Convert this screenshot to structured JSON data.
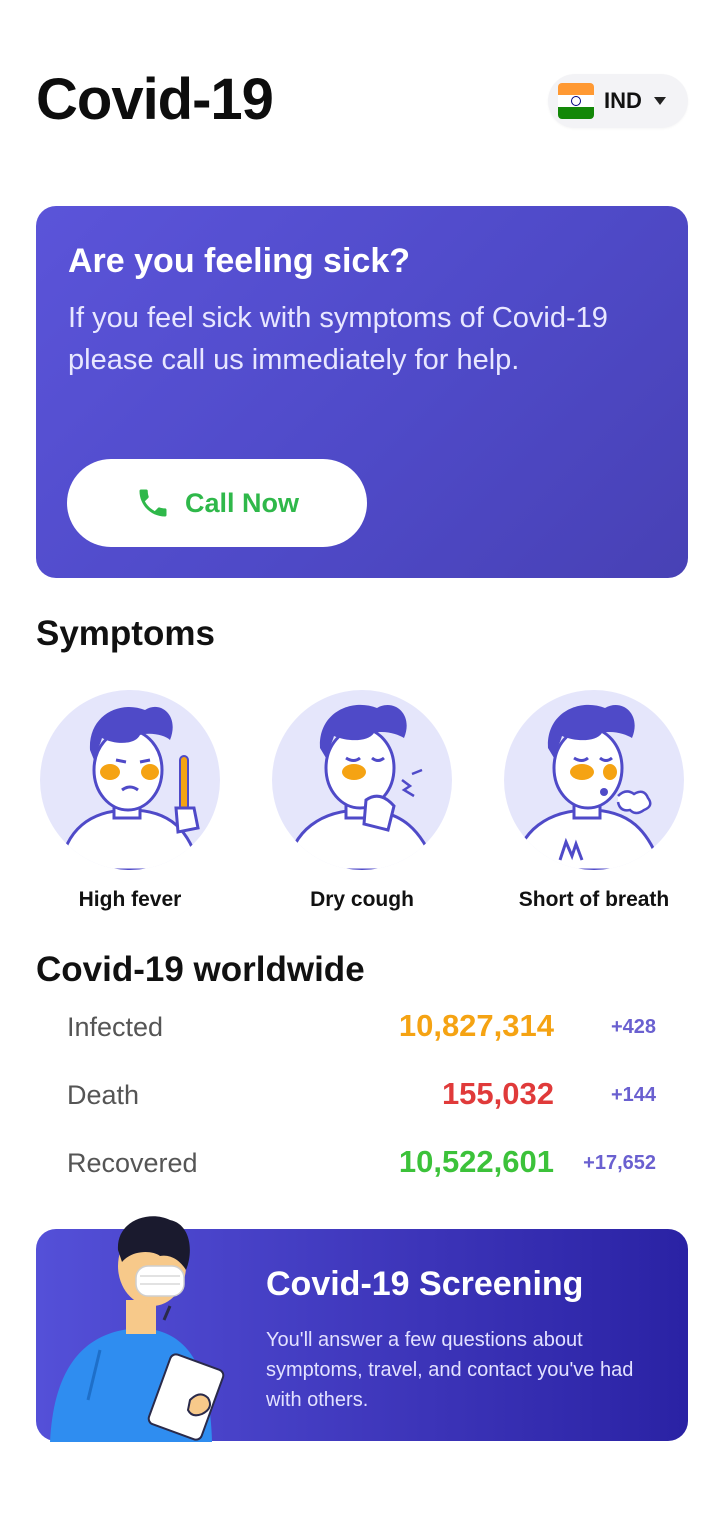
{
  "header": {
    "title": "Covid-19",
    "country": {
      "code": "IND",
      "icon": "india-flag-icon"
    }
  },
  "help_card": {
    "title": "Are you feeling sick?",
    "text": "If you feel sick with symptoms of Covid-19 please call us immediately for help.",
    "call_button": {
      "label": "Call Now",
      "icon": "phone-icon",
      "color": "#2fb84a"
    },
    "background": "#5550d4"
  },
  "symptoms": {
    "title": "Symptoms",
    "items": [
      {
        "label": "High fever",
        "icon": "high-fever-illustration"
      },
      {
        "label": "Dry cough",
        "icon": "dry-cough-illustration"
      },
      {
        "label": "Short of breath",
        "icon": "short-of-breath-illustration"
      }
    ]
  },
  "worldwide": {
    "title": "Covid-19 worldwide",
    "rows": [
      {
        "label": "Infected",
        "value": "10,827,314",
        "delta": "+428",
        "color": "#f5a313"
      },
      {
        "label": "Death",
        "value": "155,032",
        "delta": "+144",
        "color": "#e03a3a"
      },
      {
        "label": "Recovered",
        "value": "10,522,601",
        "delta": "+17,652",
        "color": "#3cc23a"
      }
    ]
  },
  "screening_card": {
    "title": "Covid-19 Screening",
    "text": "You'll answer a few questions about symptoms, travel, and contact you've had with others.",
    "icon": "doctor-with-clipboard-illustration"
  }
}
